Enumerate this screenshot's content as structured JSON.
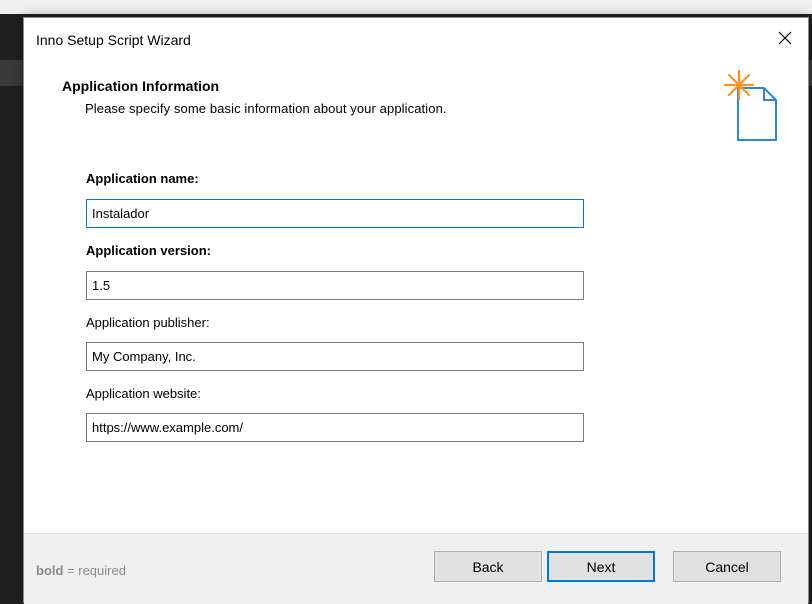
{
  "window": {
    "title": "Inno Setup Script Wizard",
    "close_glyph": "✕"
  },
  "header": {
    "title": "Application Information",
    "subtitle": "Please specify some basic information about your application.",
    "icon": "new-document-sparkle-icon",
    "icon_accent": "#f7941d",
    "icon_stroke": "#2b88d8"
  },
  "form": {
    "fields": [
      {
        "label": "Application name:",
        "required": true,
        "value": "Instalador",
        "focused": true
      },
      {
        "label": "Application version:",
        "required": true,
        "value": "1.5",
        "focused": false
      },
      {
        "label": "Application publisher:",
        "required": false,
        "value": "My Company, Inc.",
        "focused": false
      },
      {
        "label": "Application website:",
        "required": false,
        "value": "https://www.example.com/",
        "focused": false
      }
    ]
  },
  "footer": {
    "required_bold": "bold",
    "required_rest": " = required",
    "buttons": {
      "back": "Back",
      "next": "Next",
      "cancel": "Cancel"
    }
  },
  "colors": {
    "focus_border": "#0078d7",
    "footer_bg": "#f0f0f0"
  }
}
